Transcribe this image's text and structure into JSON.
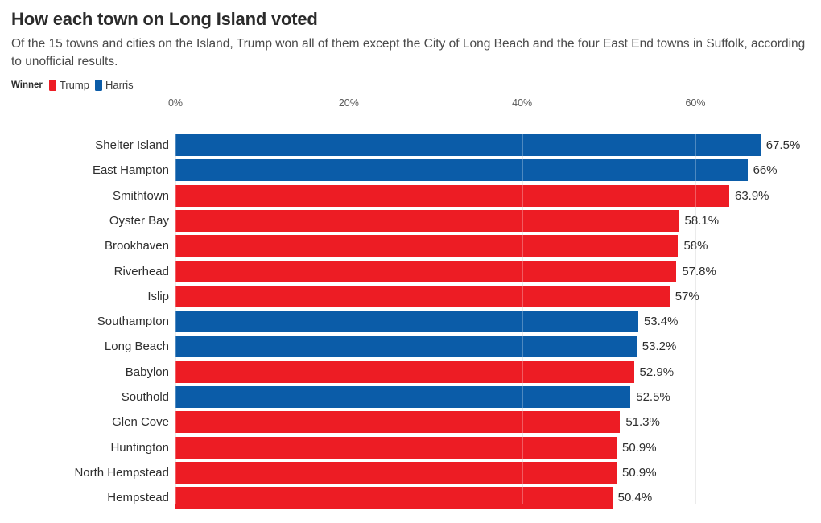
{
  "header": {
    "title": "How each town on Long Island voted",
    "subtitle": "Of the 15 towns and cities on the Island, Trump won all of them except the City of Long Beach and the four East End towns in Suffolk, according to unofficial results."
  },
  "legend": {
    "title": "Winner",
    "items": [
      {
        "label": "Trump",
        "color": "#ed1c24"
      },
      {
        "label": "Harris",
        "color": "#0b5ca8"
      }
    ]
  },
  "chart_data": {
    "type": "bar",
    "orientation": "horizontal",
    "title": "How each town on Long Island voted",
    "subtitle": "Of the 15 towns and cities on the Island, Trump won all of them except the City of Long Beach and the four East End towns in Suffolk, according to unofficial results.",
    "xlabel": "",
    "ylabel": "",
    "xlim": [
      0,
      67.5
    ],
    "grid": true,
    "legend_position": "top-left",
    "tick_labels": [
      "0%",
      "20%",
      "40%",
      "60%"
    ],
    "tick_values": [
      0,
      20,
      40,
      60
    ],
    "categories": [
      "Shelter Island",
      "East Hampton",
      "Smithtown",
      "Oyster Bay",
      "Brookhaven",
      "Riverhead",
      "Islip",
      "Southampton",
      "Long Beach",
      "Babylon",
      "Southold",
      "Glen Cove",
      "Huntington",
      "North Hempstead",
      "Hempstead"
    ],
    "values": [
      67.5,
      66,
      63.9,
      58.1,
      58,
      57.8,
      57,
      53.4,
      53.2,
      52.9,
      52.5,
      51.3,
      50.9,
      50.9,
      50.4
    ],
    "value_labels": [
      "67.5%",
      "66%",
      "63.9%",
      "58.1%",
      "58%",
      "57.8%",
      "57%",
      "53.4%",
      "53.2%",
      "52.9%",
      "52.5%",
      "51.3%",
      "50.9%",
      "50.9%",
      "50.4%"
    ],
    "winners": [
      "Harris",
      "Harris",
      "Trump",
      "Trump",
      "Trump",
      "Trump",
      "Trump",
      "Harris",
      "Harris",
      "Trump",
      "Harris",
      "Trump",
      "Trump",
      "Trump",
      "Trump"
    ],
    "colors": [
      "#0b5ca8",
      "#0b5ca8",
      "#ed1c24",
      "#ed1c24",
      "#ed1c24",
      "#ed1c24",
      "#ed1c24",
      "#0b5ca8",
      "#0b5ca8",
      "#ed1c24",
      "#0b5ca8",
      "#ed1c24",
      "#ed1c24",
      "#ed1c24",
      "#ed1c24"
    ]
  }
}
